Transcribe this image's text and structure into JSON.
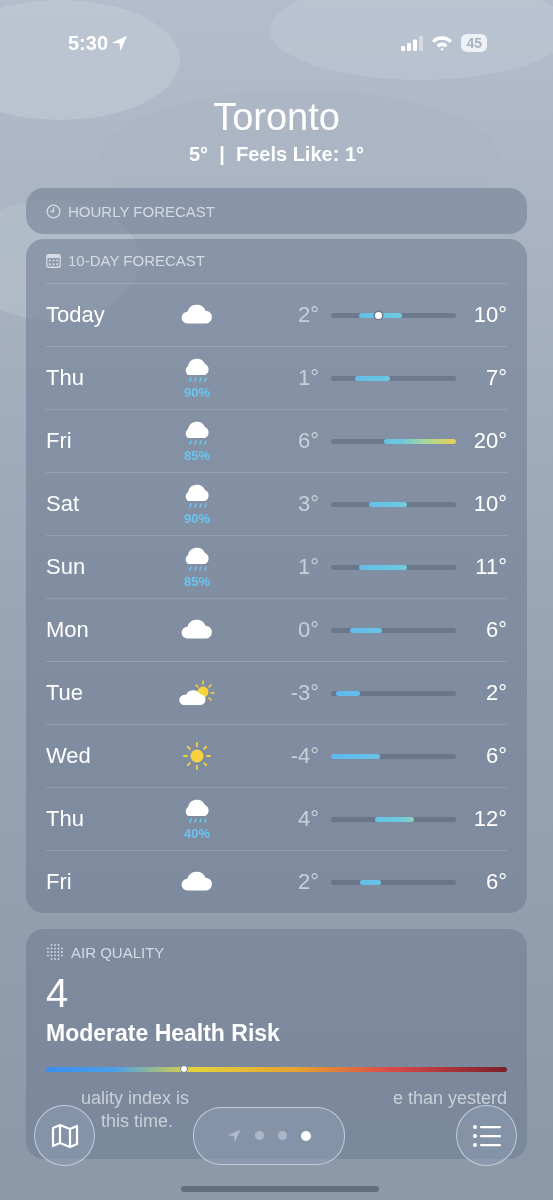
{
  "status_bar": {
    "time": "5:30",
    "location_on": true,
    "battery": "45"
  },
  "location": {
    "city": "Toronto",
    "summary": "5°  |  Feels Like: 1°"
  },
  "hourly_forecast": {
    "title": "HOURLY FORECAST"
  },
  "daily_forecast": {
    "title": "10-DAY FORECAST",
    "days": [
      {
        "day": "Today",
        "kind": "cloud",
        "low": "2°",
        "high": "10°"
      },
      {
        "day": "Thu",
        "kind": "rain",
        "chance": "90%",
        "low": "1°",
        "high": "7°"
      },
      {
        "day": "Fri",
        "kind": "rain",
        "chance": "85%",
        "low": "6°",
        "high": "20°"
      },
      {
        "day": "Sat",
        "kind": "rain",
        "chance": "90%",
        "low": "3°",
        "high": "10°"
      },
      {
        "day": "Sun",
        "kind": "rain",
        "chance": "85%",
        "low": "1°",
        "high": "11°"
      },
      {
        "day": "Mon",
        "kind": "cloud",
        "low": "0°",
        "high": "6°"
      },
      {
        "day": "Tue",
        "kind": "partly_sunny",
        "low": "-3°",
        "high": "2°"
      },
      {
        "day": "Wed",
        "kind": "sun",
        "low": "-4°",
        "high": "6°"
      },
      {
        "day": "Thu",
        "kind": "rain",
        "chance": "40%",
        "low": "4°",
        "high": "12°"
      },
      {
        "day": "Fri",
        "kind": "cloud",
        "low": "2°",
        "high": "6°"
      }
    ]
  },
  "air_quality": {
    "title": "AIR QUALITY",
    "index": "4",
    "risk": "Moderate Health Risk",
    "scale": {
      "level": 0.3
    },
    "description_parts": [
      "uality index is",
      "e than yesterd",
      "this time."
    ]
  },
  "bottom_bar": {
    "pages": [
      {
        "kind": "location",
        "selected": false
      },
      {
        "kind": "dot",
        "selected": false
      },
      {
        "kind": "dot",
        "selected": false
      },
      {
        "kind": "dot",
        "selected": true
      }
    ]
  }
}
